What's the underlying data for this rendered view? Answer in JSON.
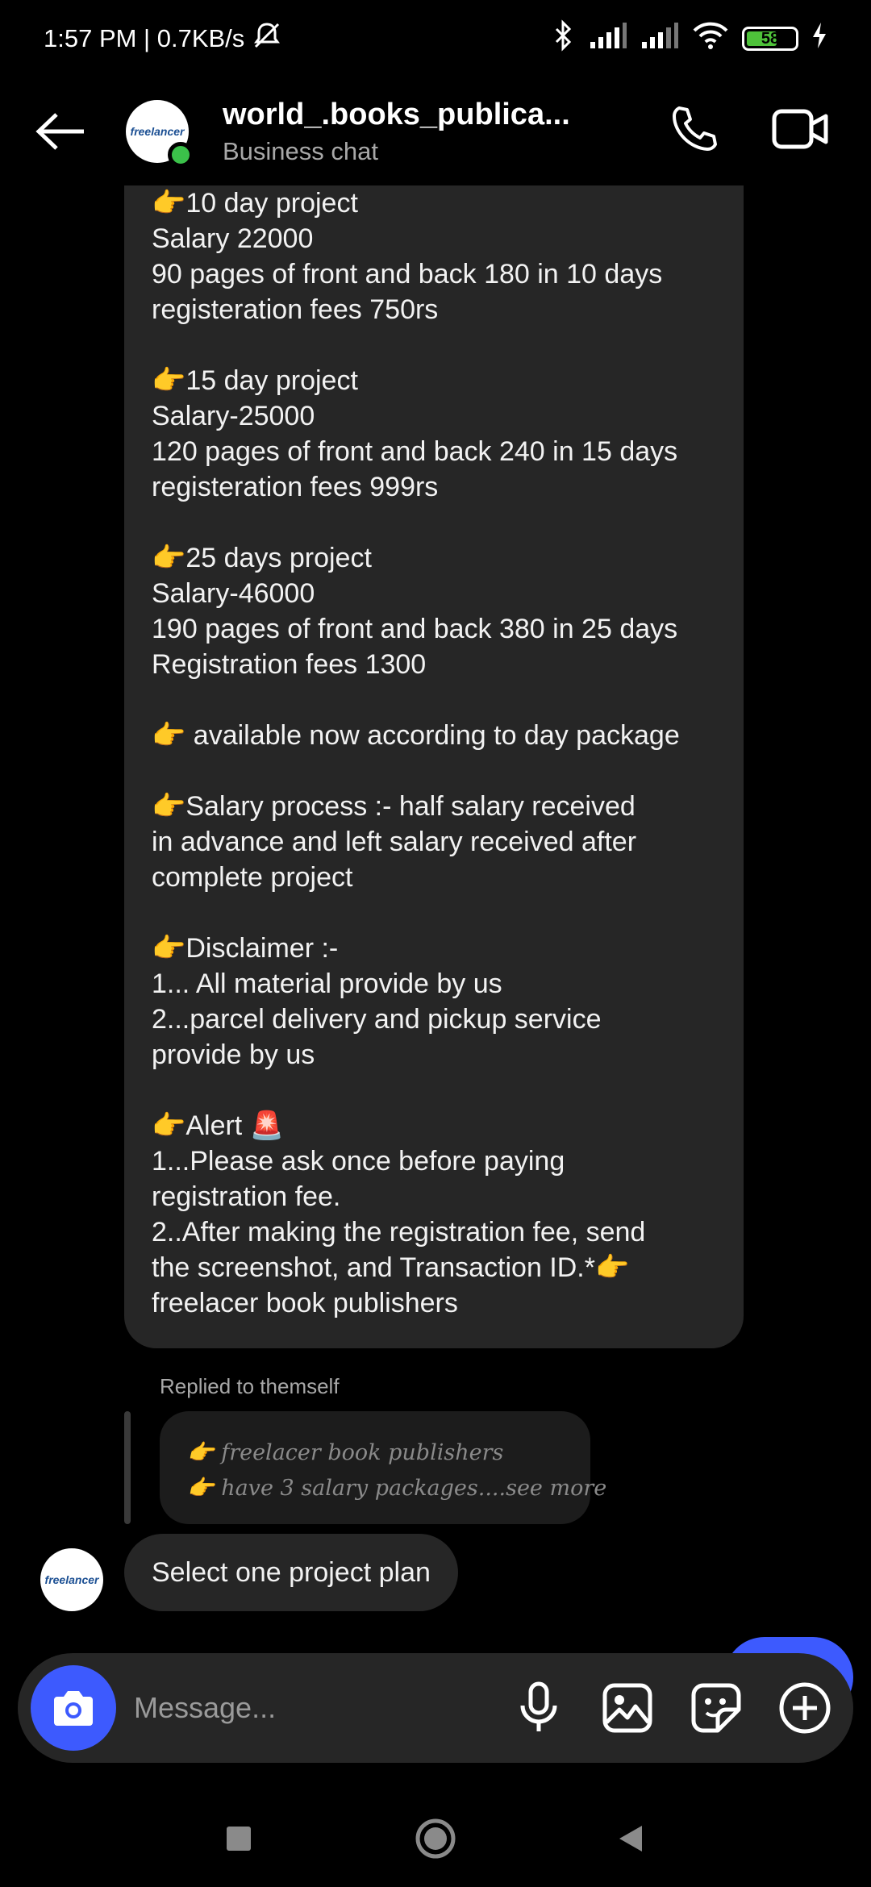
{
  "status_bar": {
    "time_speed": "1:57 PM | 0.7KB/s",
    "battery": "58",
    "icons": [
      "mute-icon",
      "bluetooth-icon",
      "signal-icon",
      "signal-icon",
      "wifi-icon",
      "battery-icon",
      "charging-icon"
    ]
  },
  "header": {
    "title": "world_.books_publica...",
    "subtitle": "Business chat",
    "avatar_text": "freelancer",
    "icons": [
      "back-arrow-icon",
      "phone-icon",
      "video-icon"
    ]
  },
  "message": {
    "lines": [
      "👉10 day project",
      "Salary 22000",
      "90 pages of front and back 180 in 10 days",
      "registeration fees 750rs",
      "",
      "👉15 day project",
      "Salary-25000",
      "120 pages of front and back 240 in 15 days",
      "registeration fees 999rs",
      "",
      "👉25 days project",
      "Salary-46000",
      "190 pages of front and back 380 in 25 days",
      "Registration fees 1300",
      "",
      "👉 available now according to day package",
      "",
      "👉Salary process :- half salary received",
      "in advance and left salary received after",
      "complete project",
      "",
      "👉Disclaimer :-",
      "1... All material provide by us",
      "2...parcel delivery and pickup service",
      "provide by us",
      "",
      "👉Alert 🚨",
      "1...Please ask once before paying",
      "registration fee.",
      "2..After making the registration fee, send",
      "the screenshot, and Transaction ID.*👉",
      "freelacer book publishers"
    ]
  },
  "reply": {
    "label": "Replied to themself",
    "line1": "👉 freelacer book publishers",
    "line2": "👉 have 3 salary packages....see more"
  },
  "small_message": {
    "text": "Select one project plan",
    "avatar_text": "freelancer"
  },
  "composer": {
    "placeholder": "Message...",
    "icons": [
      "camera-icon",
      "microphone-icon",
      "gallery-icon",
      "sticker-icon",
      "plus-icon"
    ]
  },
  "nav": {
    "icons": [
      "recents-icon",
      "home-icon",
      "back-icon"
    ]
  },
  "colors": {
    "accent": "#3d5afe",
    "bubble": "#262626",
    "online": "#3bc14a",
    "battery_fill": "#4ec23a"
  }
}
